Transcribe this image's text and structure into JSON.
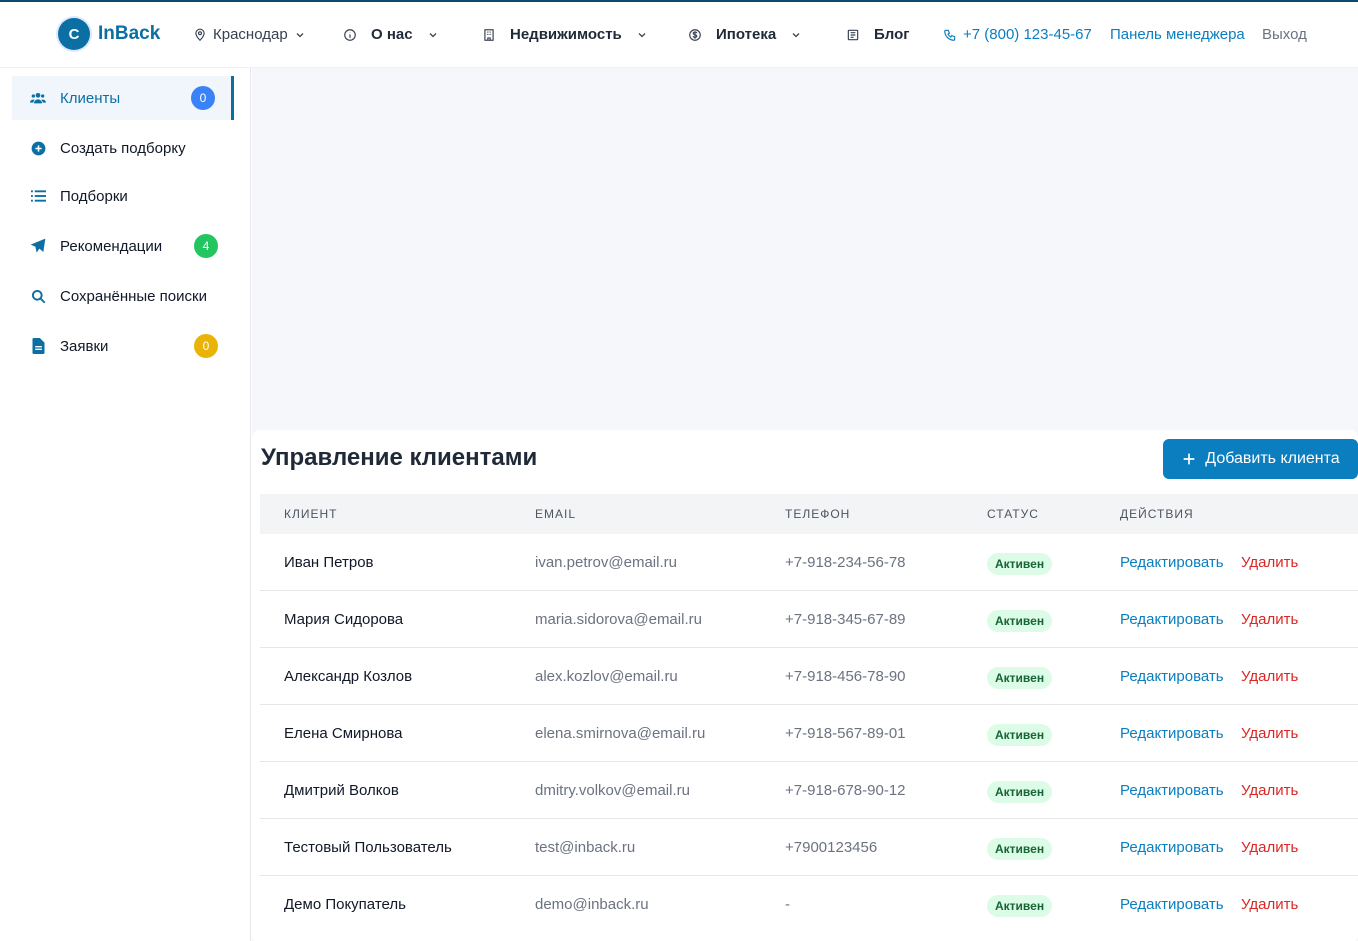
{
  "header": {
    "logo_letter": "C",
    "logo_text": "InBack",
    "city": "Краснодар",
    "nav": [
      {
        "label": "О нас"
      },
      {
        "label": "Недвижимость"
      },
      {
        "label": "Ипотека"
      },
      {
        "label": "Блог"
      }
    ],
    "phone": "+7 (800) 123-45-67",
    "manager_panel": "Панель менеджера",
    "logout": "Выход"
  },
  "sidebar": {
    "items": [
      {
        "label": "Клиенты",
        "badge": "0",
        "badge_color": "#3b82f6"
      },
      {
        "label": "Создать подборку"
      },
      {
        "label": "Подборки"
      },
      {
        "label": "Рекомендации",
        "badge": "4",
        "badge_color": "#22c55e"
      },
      {
        "label": "Сохранённые поиски"
      },
      {
        "label": "Заявки",
        "badge": "0",
        "badge_color": "#eab308"
      }
    ]
  },
  "main": {
    "title": "Управление клиентами",
    "add_button": "Добавить клиента",
    "columns": [
      "КЛИЕНТ",
      "EMAIL",
      "ТЕЛЕФОН",
      "СТАТУС",
      "ДЕЙСТВИЯ"
    ],
    "edit_label": "Редактировать",
    "delete_label": "Удалить",
    "rows": [
      {
        "name": "Иван Петров",
        "email": "ivan.petrov@email.ru",
        "phone": "+7-918-234-56-78",
        "status": "Активен"
      },
      {
        "name": "Мария Сидорова",
        "email": "maria.sidorova@email.ru",
        "phone": "+7-918-345-67-89",
        "status": "Активен"
      },
      {
        "name": "Александр Козлов",
        "email": "alex.kozlov@email.ru",
        "phone": "+7-918-456-78-90",
        "status": "Активен"
      },
      {
        "name": "Елена Смирнова",
        "email": "elena.smirnova@email.ru",
        "phone": "+7-918-567-89-01",
        "status": "Активен"
      },
      {
        "name": "Дмитрий Волков",
        "email": "dmitry.volkov@email.ru",
        "phone": "+7-918-678-90-12",
        "status": "Активен"
      },
      {
        "name": "Тестовый Пользователь",
        "email": "test@inback.ru",
        "phone": "+7900123456",
        "status": "Активен"
      },
      {
        "name": "Демо Покупатель",
        "email": "demo@inback.ru",
        "phone": "-",
        "status": "Активен"
      }
    ]
  }
}
